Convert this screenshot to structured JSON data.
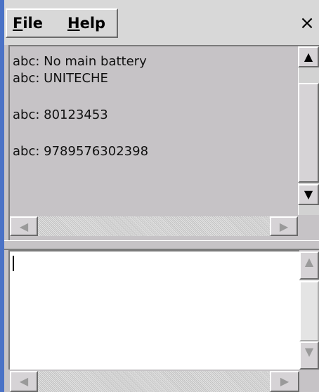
{
  "menu": {
    "file_accel": "F",
    "file_rest": "ile",
    "help_accel": "H",
    "help_rest": "elp"
  },
  "close_glyph": "×",
  "output_lines": [
    "abc: No main battery",
    "abc: UNITECHE",
    "abc: 80123453",
    "abc: 9789576302398"
  ],
  "input_text": "",
  "glyphs": {
    "up": "▲",
    "down": "▼",
    "left": "◀",
    "right": "▶"
  }
}
